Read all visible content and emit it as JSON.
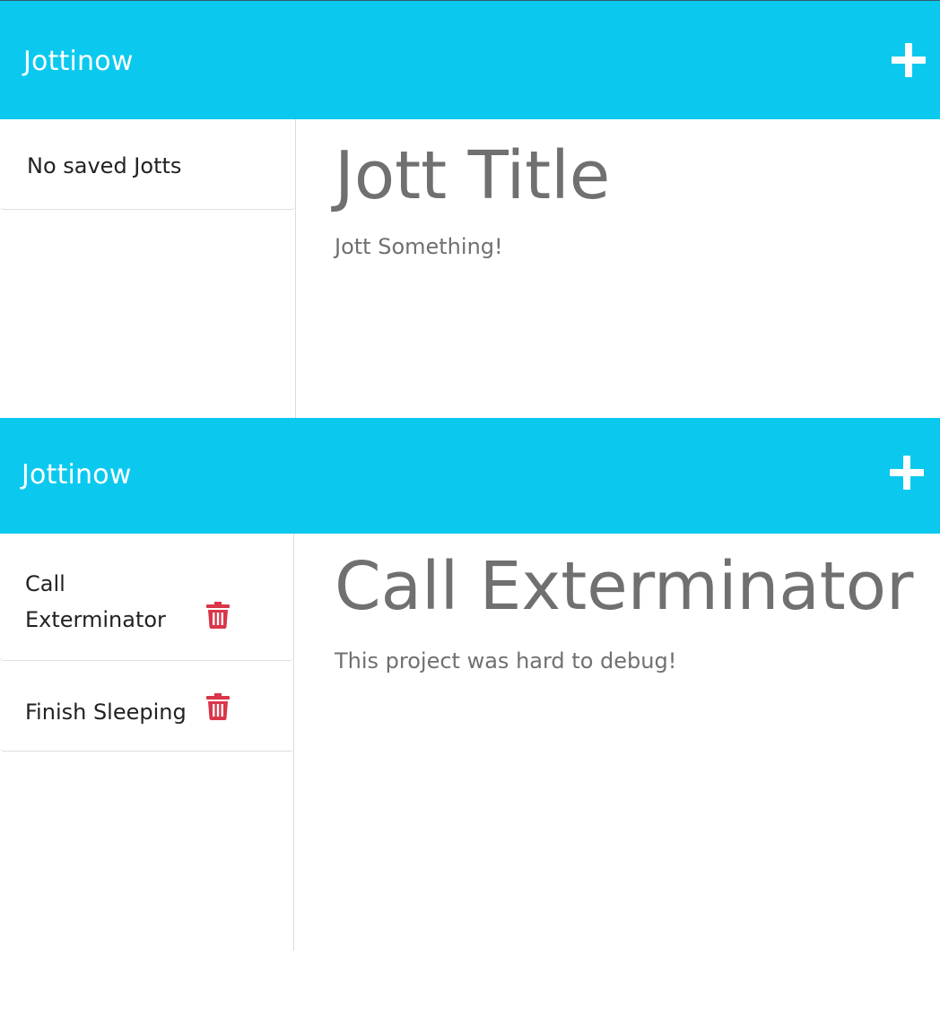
{
  "panels": [
    {
      "navbar": {
        "brand": "Jottinow",
        "add_icon": "plus-icon"
      },
      "sidebar": {
        "empty_text": "No saved Jotts",
        "items": []
      },
      "main": {
        "title": "Jott Title",
        "body": "Jott Something!"
      }
    },
    {
      "navbar": {
        "brand": "Jottinow",
        "add_icon": "plus-icon"
      },
      "sidebar": {
        "items": [
          {
            "title": "Call Exterminator",
            "delete_icon": "trash-icon"
          },
          {
            "title": "Finish Sleeping",
            "delete_icon": "trash-icon"
          }
        ]
      },
      "main": {
        "title": "Call Exterminator",
        "body": "This project was hard to debug!"
      }
    }
  ],
  "colors": {
    "navbar": "#0bc9ee",
    "brand_text": "#ffffff",
    "delete_icon": "#d9364a",
    "main_text": "#707070",
    "list_text": "#222222"
  }
}
